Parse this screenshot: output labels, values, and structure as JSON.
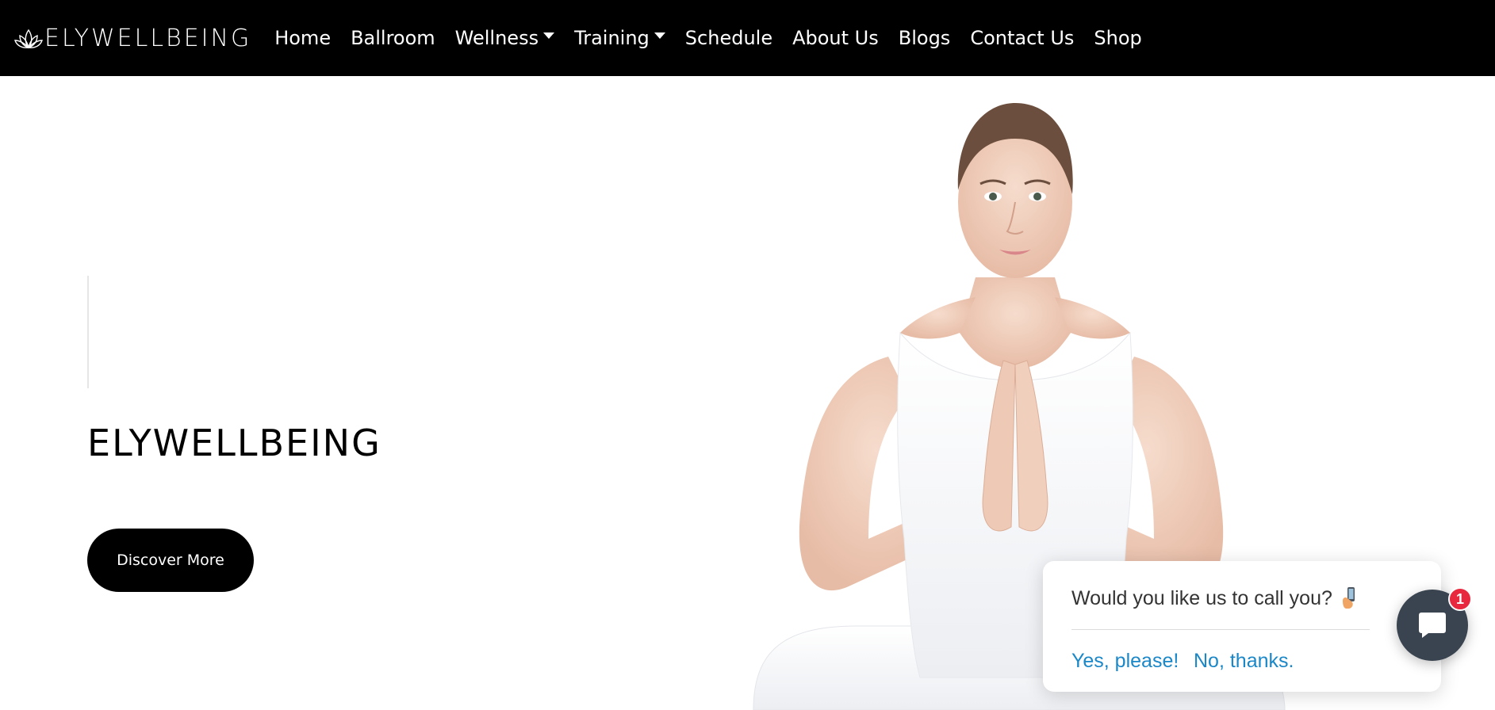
{
  "brand": {
    "name": "ELYWELLBEING",
    "logo_icon": "lotus-icon"
  },
  "nav": {
    "items": [
      {
        "label": "Home",
        "dropdown": false
      },
      {
        "label": "Ballroom",
        "dropdown": false
      },
      {
        "label": "Wellness",
        "dropdown": true
      },
      {
        "label": "Training",
        "dropdown": true
      },
      {
        "label": "Schedule",
        "dropdown": false
      },
      {
        "label": "About Us",
        "dropdown": false
      },
      {
        "label": "Blogs",
        "dropdown": false
      },
      {
        "label": "Contact Us",
        "dropdown": false
      },
      {
        "label": "Shop",
        "dropdown": false
      }
    ]
  },
  "hero": {
    "title": "ELYWELLBEING",
    "cta_label": "Discover More"
  },
  "callback": {
    "question": "Would you like us to call you?",
    "icon": "phone-in-hand-icon",
    "yes_label": "Yes, please!",
    "no_label": "No, thanks."
  },
  "chat": {
    "icon": "chat-bubble-icon",
    "badge_count": "1"
  },
  "colors": {
    "nav_bg": "#000000",
    "link_blue": "#1a87c8",
    "badge_red": "#e8283f",
    "chat_bg": "#3a4450"
  }
}
